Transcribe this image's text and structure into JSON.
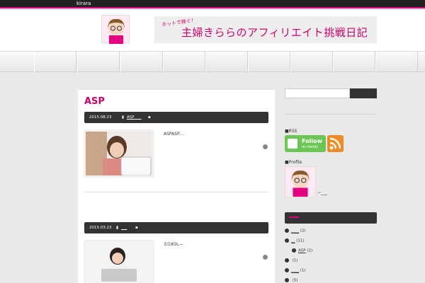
{
  "topbar": {
    "site_name": "kirara"
  },
  "header": {
    "tagline": "ネットで稼ぐ！",
    "title": "主婦きららのアフィリエイト挑戦日記"
  },
  "nav": {
    "items": [
      "",
      "",
      "",
      "",
      "",
      "",
      "",
      "",
      "",
      ""
    ]
  },
  "main": {
    "page_title": "ASP",
    "posts": [
      {
        "date": "2015.08.23",
        "category": "ASP ___",
        "excerpt": "ASPASP...."
      },
      {
        "date": "2015.03.23",
        "category": "___",
        "excerpt": "3/19OL—"
      }
    ]
  },
  "sidebar": {
    "rss_label": "■RSS",
    "feedly": {
      "line1": "Follow",
      "line2": "on feedly"
    },
    "profile_label": "■Profile",
    "profile_text": "~___",
    "categories": [
      {
        "name": "____",
        "count": "(2)"
      },
      {
        "name": "__",
        "count": "(11)"
      },
      {
        "name": "ASP",
        "count": "(2)"
      },
      {
        "name": "",
        "count": "(1)"
      },
      {
        "name": "____",
        "count": "(1)"
      },
      {
        "name": "",
        "count": "(5)"
      }
    ]
  }
}
